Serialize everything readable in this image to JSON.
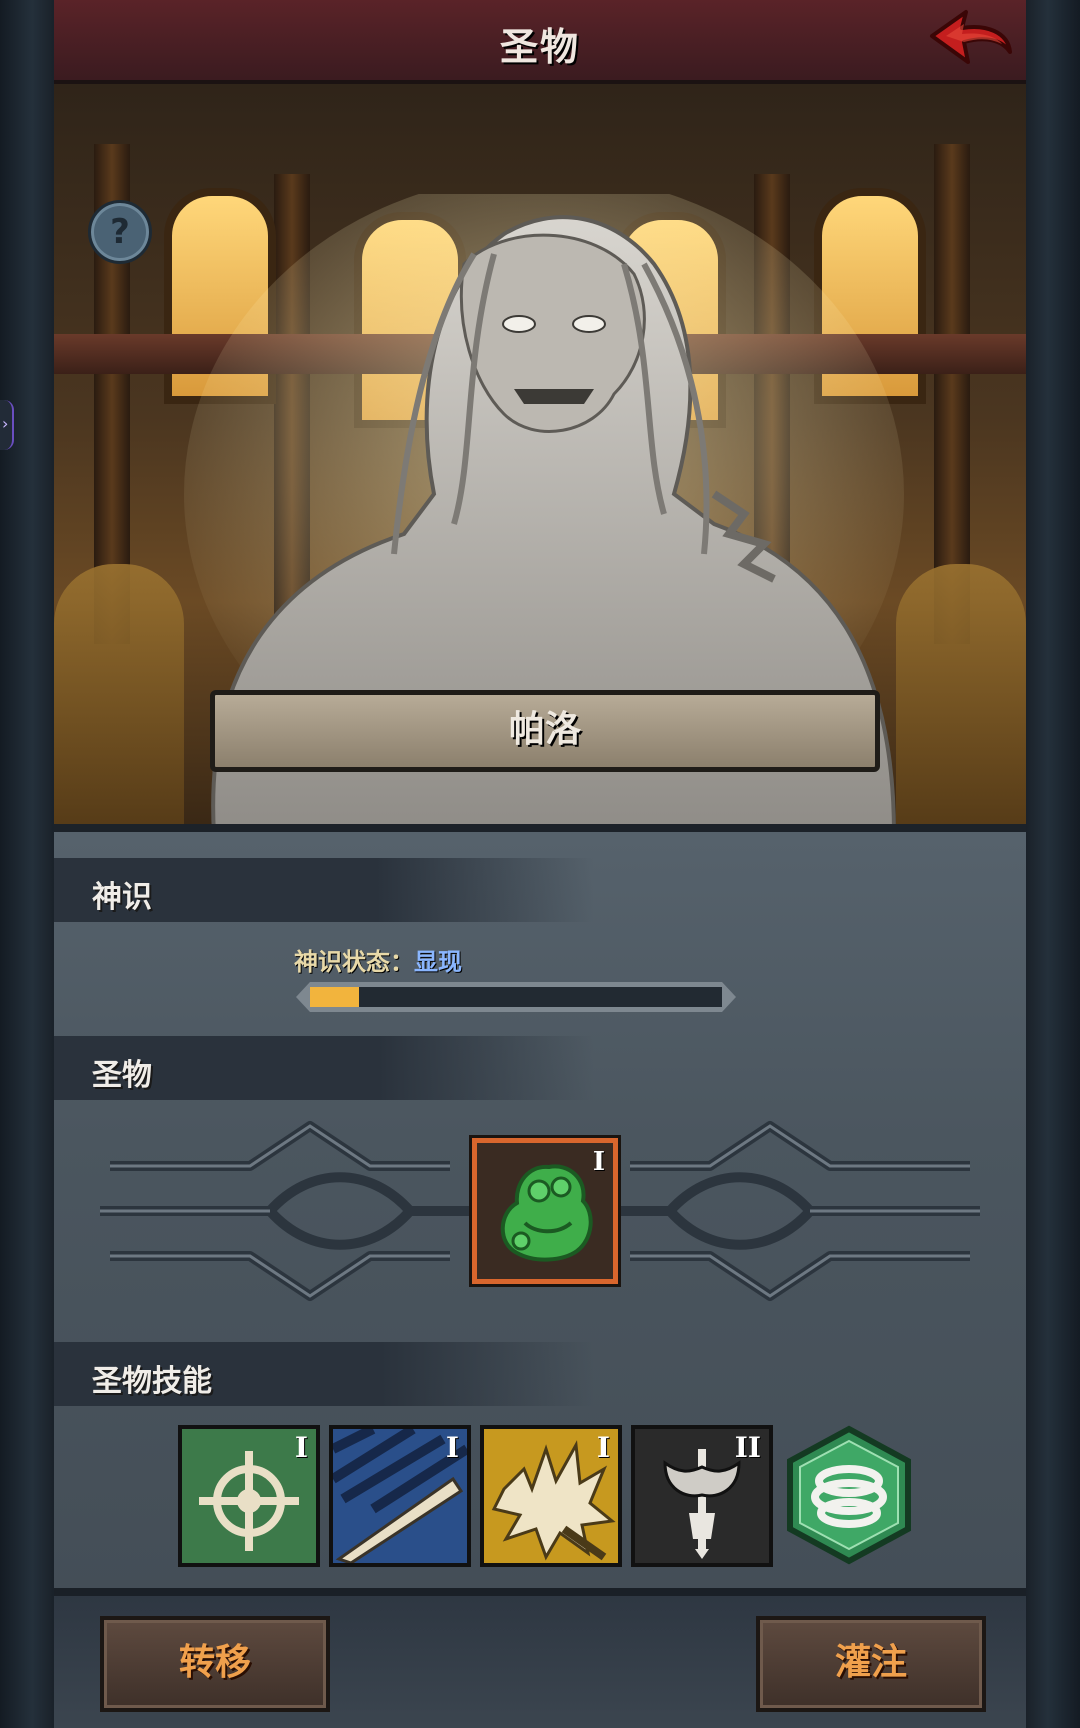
{
  "header": {
    "title": "圣物",
    "back_icon": "back-arrow-icon"
  },
  "hero": {
    "name": "帕洛",
    "help_icon": "question-mark-icon",
    "help_symbol": "?"
  },
  "divine_sense": {
    "title": "神识",
    "status_label": "神识状态：",
    "status_value": "显现",
    "progress": 0.12
  },
  "relic": {
    "title": "圣物",
    "item": {
      "icon": "green-idol-icon",
      "level": "I"
    }
  },
  "relic_skills": {
    "title": "圣物技能",
    "skills": [
      {
        "icon": "crosshair-icon",
        "level": "I"
      },
      {
        "icon": "blade-slash-icon",
        "level": "I"
      },
      {
        "icon": "beast-claw-icon",
        "level": "I"
      },
      {
        "icon": "axe-shield-icon",
        "level": "II"
      },
      {
        "icon": "swirl-hexagon-icon",
        "level": ""
      }
    ]
  },
  "actions": {
    "transfer": "转移",
    "infuse": "灌注"
  },
  "colors": {
    "accent_orange": "#f0a04c",
    "progress": "#f2b43d",
    "status_blue": "#8ab6ff",
    "header": "#5a2328"
  }
}
